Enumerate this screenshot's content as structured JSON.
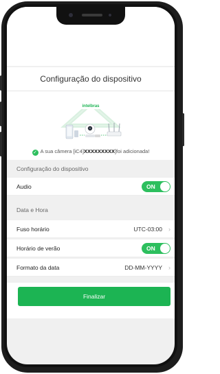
{
  "header": {
    "title": "Configuração do dispositivo"
  },
  "hero": {
    "brand": "intelbras",
    "added_prefix": "A sua câmera [iC4]",
    "added_id": "XXXXXXXXX",
    "added_suffix": "]foi adicionada!"
  },
  "device_settings": {
    "section_label": "Configuração do dispositivo",
    "audio": {
      "label": "Audio",
      "toggle_text": "ON"
    }
  },
  "date_time": {
    "section_label": "Data e Hora",
    "timezone": {
      "label": "Fuso horário",
      "value": "UTC-03:00"
    },
    "dst": {
      "label": "Horário de verão",
      "toggle_text": "ON"
    },
    "date_format": {
      "label": "Formato da data",
      "value": "DD-MM-YYYY"
    }
  },
  "actions": {
    "finish_label": "Finalizar"
  },
  "colors": {
    "accent": "#1cb453",
    "toggle": "#2dbf5e"
  }
}
